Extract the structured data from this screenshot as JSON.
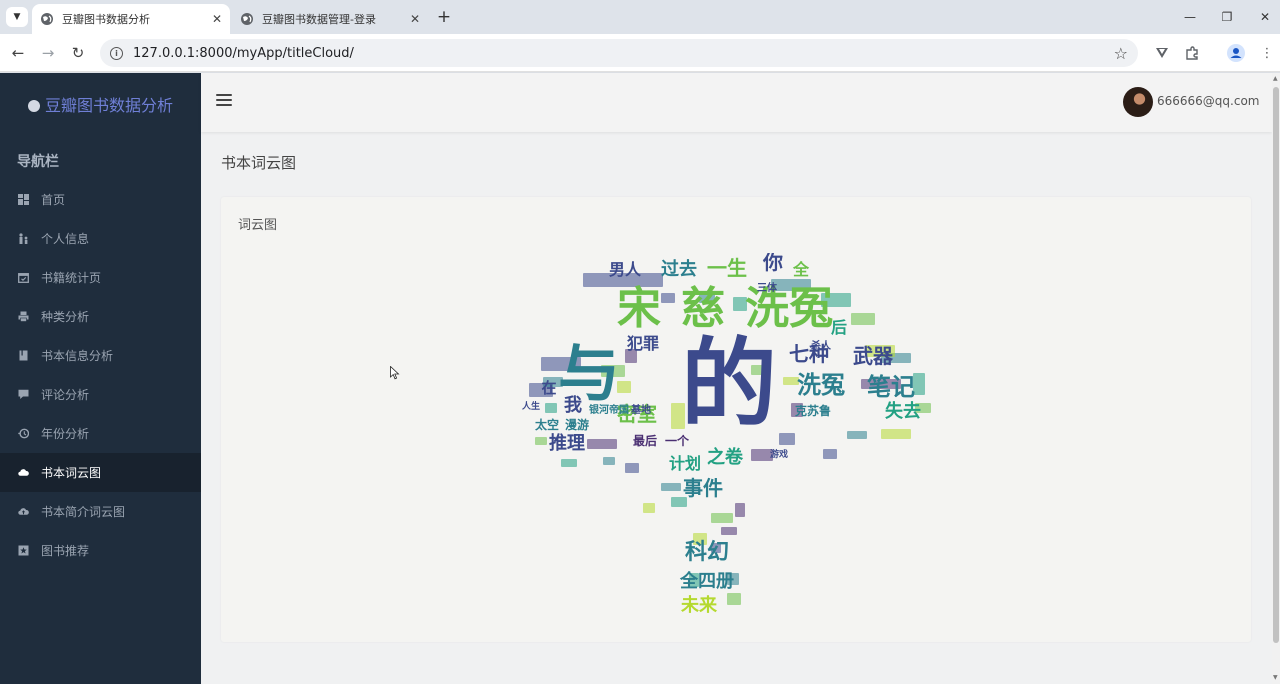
{
  "browser": {
    "tabs": [
      {
        "title": "豆瓣图书数据分析",
        "active": true
      },
      {
        "title": "豆瓣图书数据管理-登录",
        "active": false
      }
    ],
    "url": "127.0.0.1:8000/myApp/titleCloud/"
  },
  "sidebar": {
    "brand": "豆瓣图书数据分析",
    "nav_heading": "导航栏",
    "items": [
      {
        "label": "首页",
        "icon": "dashboard-icon"
      },
      {
        "label": "个人信息",
        "icon": "user-icon"
      },
      {
        "label": "书籍统计页",
        "icon": "calendar-icon"
      },
      {
        "label": "种类分析",
        "icon": "print-icon"
      },
      {
        "label": "书本信息分析",
        "icon": "book-icon"
      },
      {
        "label": "评论分析",
        "icon": "comment-icon"
      },
      {
        "label": "年份分析",
        "icon": "history-icon"
      },
      {
        "label": "书本词云图",
        "icon": "cloud-icon",
        "active": true
      },
      {
        "label": "书本简介词云图",
        "icon": "cloud-upload-icon"
      },
      {
        "label": "图书推荐",
        "icon": "star-box-icon"
      }
    ]
  },
  "header": {
    "user_email": "666666@qq.com"
  },
  "page": {
    "title": "书本词云图",
    "card_title": "词云图"
  },
  "wordcloud": {
    "shape": "tree",
    "palette": [
      "#3c4a8c",
      "#2c7f8e",
      "#23a183",
      "#6cc04a",
      "#b5d930",
      "#4a2f72"
    ],
    "words": [
      {
        "text": "的",
        "color": "#3c4a8c"
      },
      {
        "text": "与",
        "color": "#2c7f8e"
      },
      {
        "text": "宋",
        "color": "#6cc04a"
      },
      {
        "text": "慈",
        "color": "#6cc04a"
      },
      {
        "text": "洗冤",
        "color": "#6cc04a"
      },
      {
        "text": "七种",
        "color": "#3c4a8c"
      },
      {
        "text": "武器",
        "color": "#3c4a8c"
      },
      {
        "text": "洗冤",
        "color": "#2c7f8e"
      },
      {
        "text": "笔记",
        "color": "#2c7f8e"
      },
      {
        "text": "男人",
        "color": "#3c4a8c"
      },
      {
        "text": "过去",
        "color": "#2c7f8e"
      },
      {
        "text": "一生",
        "color": "#6cc04a"
      },
      {
        "text": "你",
        "color": "#3c4a8c"
      },
      {
        "text": "全",
        "color": "#6cc04a"
      },
      {
        "text": "犯罪",
        "color": "#3c4a8c"
      },
      {
        "text": "我",
        "color": "#3c4a8c"
      },
      {
        "text": "在",
        "color": "#3c4a8c"
      },
      {
        "text": "推理",
        "color": "#3c4a8c"
      },
      {
        "text": "密室",
        "color": "#6cc04a"
      },
      {
        "text": "计划",
        "color": "#23a183"
      },
      {
        "text": "之卷",
        "color": "#23a183"
      },
      {
        "text": "事件",
        "color": "#2c7f8e"
      },
      {
        "text": "科幻",
        "color": "#2c7f8e"
      },
      {
        "text": "全四册",
        "color": "#2c7f8e"
      },
      {
        "text": "未来",
        "color": "#b5d930"
      },
      {
        "text": "失去",
        "color": "#23a183"
      },
      {
        "text": "后",
        "color": "#23a183"
      },
      {
        "text": "一个",
        "color": "#4a2f72"
      },
      {
        "text": "最后",
        "color": "#4a2f72"
      },
      {
        "text": "太空",
        "color": "#2c7f8e"
      },
      {
        "text": "漫游",
        "color": "#2c7f8e"
      },
      {
        "text": "三体",
        "color": "#3c4a8c"
      },
      {
        "text": "人生",
        "color": "#3c4a8c"
      },
      {
        "text": "克苏鲁",
        "color": "#2c7f8e"
      },
      {
        "text": "杀人",
        "color": "#3c4a8c"
      },
      {
        "text": "游戏",
        "color": "#3c4a8c"
      },
      {
        "text": "银河帝国",
        "color": "#2c7f8e"
      },
      {
        "text": "基地",
        "color": "#3c4a8c"
      }
    ]
  }
}
